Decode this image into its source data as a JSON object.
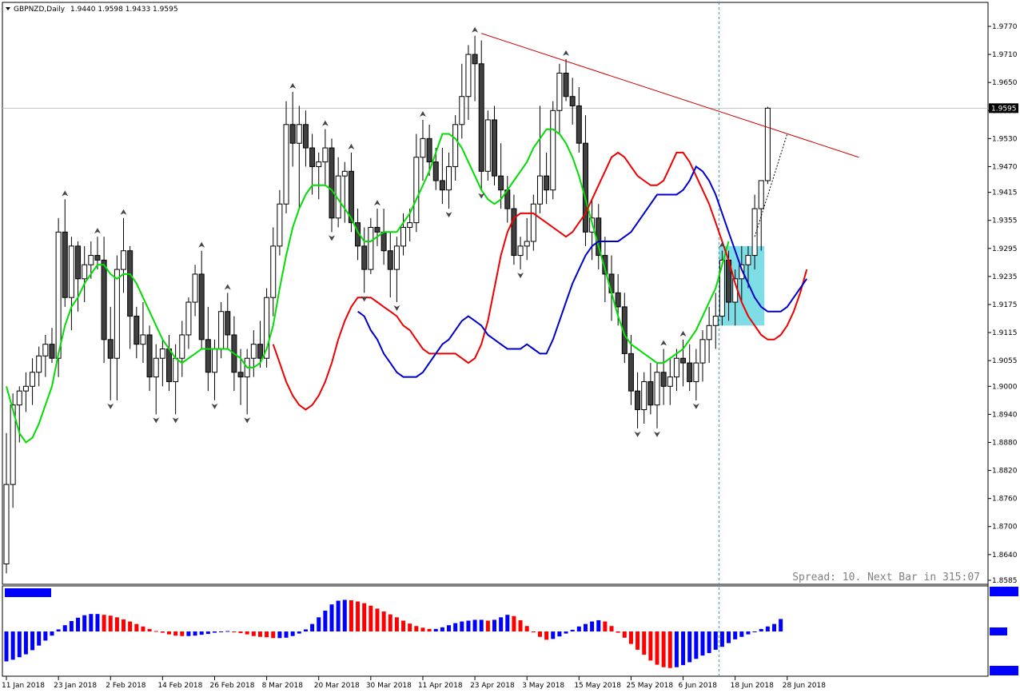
{
  "header": {
    "symbol_label": "GBPNZD,Daily",
    "ohlc_label": "1.9440 1.9598 1.9433 1.9595",
    "menu_icon": "triangle-down-icon"
  },
  "status": {
    "spread_text": "Spread: 10. Next Bar in 315:07"
  },
  "colors": {
    "background": "#ffffff",
    "grid_border": "#000000",
    "bull_body": "#ffffff",
    "bear_body": "#404040",
    "ma_fast": "#00dd00",
    "ma_mid": "#ee0000",
    "ma_slow": "#0000cc",
    "trendline": "#cc0000",
    "zone": "#7fdde6",
    "hist_up": "#0000ff",
    "hist_down": "#ff0000",
    "vline": "#2a9db5",
    "price_line": "#c0c0c0"
  },
  "chart_data": {
    "type": "candlestick",
    "symbol": "GBPNZD",
    "timeframe": "Daily",
    "y_ticks": [
      "1.9770",
      "1.9710",
      "1.9650",
      "1.9590",
      "1.9530",
      "1.9470",
      "1.9415",
      "1.9355",
      "1.9295",
      "1.9235",
      "1.9175",
      "1.9115",
      "1.9055",
      "1.9000",
      "1.8940",
      "1.8880",
      "1.8820",
      "1.8760",
      "1.8700",
      "1.8640",
      "1.8585"
    ],
    "ylim": [
      1.8575,
      1.981
    ],
    "x_ticks": [
      "11 Jan 2018",
      "23 Jan 2018",
      "2 Feb 2018",
      "14 Feb 2018",
      "26 Feb 2018",
      "8 Mar 2018",
      "20 Mar 2018",
      "30 Mar 2018",
      "11 Apr 2018",
      "23 Apr 2018",
      "3 May 2018",
      "15 May 2018",
      "25 May 2018",
      "6 Jun 2018",
      "18 Jun 2018",
      "28 Jun 2018"
    ],
    "x_tick_index": [
      0,
      8,
      16,
      24,
      32,
      40,
      48,
      56,
      64,
      72,
      80,
      88,
      96,
      104,
      112,
      120
    ],
    "current_price": "1.9595",
    "candles": [
      [
        1.862,
        1.89,
        1.86,
        1.879
      ],
      [
        1.879,
        1.8985,
        1.874,
        1.896
      ],
      [
        1.896,
        1.9,
        1.888,
        1.899
      ],
      [
        1.899,
        1.903,
        1.8945,
        1.9
      ],
      [
        1.9,
        1.906,
        1.896,
        1.903
      ],
      [
        1.903,
        1.9085,
        1.9,
        1.9065
      ],
      [
        1.9065,
        1.911,
        1.902,
        1.909
      ],
      [
        1.909,
        1.9125,
        1.905,
        1.906
      ],
      [
        1.906,
        1.936,
        1.902,
        1.933
      ],
      [
        1.933,
        1.94,
        1.917,
        1.919
      ],
      [
        1.919,
        1.932,
        1.912,
        1.93
      ],
      [
        1.93,
        1.931,
        1.916,
        1.923
      ],
      [
        1.923,
        1.93,
        1.918,
        1.926
      ],
      [
        1.926,
        1.931,
        1.923,
        1.928
      ],
      [
        1.928,
        1.932,
        1.925,
        1.927
      ],
      [
        1.927,
        1.932,
        1.905,
        1.91
      ],
      [
        1.91,
        1.917,
        1.897,
        1.906
      ],
      [
        1.906,
        1.928,
        1.897,
        1.925
      ],
      [
        1.925,
        1.936,
        1.92,
        1.929
      ],
      [
        1.929,
        1.93,
        1.908,
        1.915
      ],
      [
        1.915,
        1.917,
        1.906,
        1.909
      ],
      [
        1.909,
        1.918,
        1.905,
        1.911
      ],
      [
        1.911,
        1.913,
        1.899,
        1.902
      ],
      [
        1.902,
        1.909,
        1.894,
        1.906
      ],
      [
        1.906,
        1.91,
        1.9,
        1.908
      ],
      [
        1.908,
        1.911,
        1.899,
        1.901
      ],
      [
        1.901,
        1.909,
        1.894,
        1.906
      ],
      [
        1.906,
        1.914,
        1.902,
        1.911
      ],
      [
        1.911,
        1.919,
        1.908,
        1.918
      ],
      [
        1.918,
        1.926,
        1.915,
        1.924
      ],
      [
        1.924,
        1.929,
        1.908,
        1.91
      ],
      [
        1.91,
        1.917,
        1.899,
        1.903
      ],
      [
        1.903,
        1.91,
        1.897,
        1.908
      ],
      [
        1.908,
        1.918,
        1.906,
        1.916
      ],
      [
        1.916,
        1.92,
        1.908,
        1.911
      ],
      [
        1.911,
        1.915,
        1.899,
        1.903
      ],
      [
        1.903,
        1.908,
        1.896,
        1.902
      ],
      [
        1.902,
        1.908,
        1.894,
        1.906
      ],
      [
        1.906,
        1.912,
        1.902,
        1.909
      ],
      [
        1.909,
        1.914,
        1.904,
        1.906
      ],
      [
        1.906,
        1.921,
        1.904,
        1.919
      ],
      [
        1.919,
        1.934,
        1.915,
        1.93
      ],
      [
        1.93,
        1.942,
        1.928,
        1.939
      ],
      [
        1.939,
        1.961,
        1.937,
        1.956
      ],
      [
        1.956,
        1.963,
        1.947,
        1.952
      ],
      [
        1.952,
        1.96,
        1.938,
        1.956
      ],
      [
        1.956,
        1.959,
        1.947,
        1.951
      ],
      [
        1.951,
        1.954,
        1.941,
        1.947
      ],
      [
        1.947,
        1.95,
        1.94,
        1.948
      ],
      [
        1.948,
        1.955,
        1.943,
        1.951
      ],
      [
        1.951,
        1.953,
        1.933,
        1.936
      ],
      [
        1.936,
        1.949,
        1.934,
        1.945
      ],
      [
        1.945,
        1.948,
        1.935,
        1.946
      ],
      [
        1.946,
        1.95,
        1.933,
        1.935
      ],
      [
        1.935,
        1.938,
        1.927,
        1.93
      ],
      [
        1.93,
        1.934,
        1.92,
        1.925
      ],
      [
        1.925,
        1.936,
        1.924,
        1.934
      ],
      [
        1.934,
        1.938,
        1.93,
        1.933
      ],
      [
        1.933,
        1.938,
        1.926,
        1.929
      ],
      [
        1.929,
        1.933,
        1.919,
        1.925
      ],
      [
        1.925,
        1.932,
        1.918,
        1.93
      ],
      [
        1.93,
        1.937,
        1.928,
        1.934
      ],
      [
        1.934,
        1.938,
        1.931,
        1.935
      ],
      [
        1.935,
        1.954,
        1.933,
        1.949
      ],
      [
        1.949,
        1.957,
        1.944,
        1.953
      ],
      [
        1.953,
        1.956,
        1.945,
        1.948
      ],
      [
        1.948,
        1.951,
        1.942,
        1.944
      ],
      [
        1.944,
        1.951,
        1.939,
        1.942
      ],
      [
        1.942,
        1.95,
        1.938,
        1.947
      ],
      [
        1.947,
        1.958,
        1.944,
        1.956
      ],
      [
        1.956,
        1.969,
        1.953,
        1.962
      ],
      [
        1.962,
        1.973,
        1.957,
        1.971
      ],
      [
        1.971,
        1.975,
        1.961,
        1.969
      ],
      [
        1.969,
        1.974,
        1.942,
        1.946
      ],
      [
        1.946,
        1.959,
        1.944,
        1.957
      ],
      [
        1.957,
        1.96,
        1.943,
        1.945
      ],
      [
        1.945,
        1.952,
        1.938,
        1.942
      ],
      [
        1.942,
        1.945,
        1.935,
        1.938
      ],
      [
        1.938,
        1.941,
        1.926,
        1.928
      ],
      [
        1.928,
        1.932,
        1.925,
        1.93
      ],
      [
        1.93,
        1.936,
        1.927,
        1.931
      ],
      [
        1.931,
        1.941,
        1.929,
        1.939
      ],
      [
        1.939,
        1.96,
        1.937,
        1.945
      ],
      [
        1.945,
        1.95,
        1.939,
        1.942
      ],
      [
        1.942,
        1.961,
        1.94,
        1.959
      ],
      [
        1.959,
        1.969,
        1.954,
        1.967
      ],
      [
        1.967,
        1.97,
        1.961,
        1.962
      ],
      [
        1.962,
        1.966,
        1.956,
        1.96
      ],
      [
        1.96,
        1.964,
        1.95,
        1.952
      ],
      [
        1.952,
        1.958,
        1.93,
        1.933
      ],
      [
        1.933,
        1.94,
        1.927,
        1.936
      ],
      [
        1.936,
        1.939,
        1.925,
        1.928
      ],
      [
        1.928,
        1.932,
        1.918,
        1.924
      ],
      [
        1.924,
        1.928,
        1.914,
        1.92
      ],
      [
        1.92,
        1.924,
        1.913,
        1.917
      ],
      [
        1.917,
        1.92,
        1.905,
        1.907
      ],
      [
        1.907,
        1.911,
        1.896,
        1.899
      ],
      [
        1.899,
        1.903,
        1.891,
        1.895
      ],
      [
        1.895,
        1.903,
        1.892,
        1.901
      ],
      [
        1.901,
        1.905,
        1.894,
        1.896
      ],
      [
        1.896,
        1.905,
        1.891,
        1.903
      ],
      [
        1.903,
        1.908,
        1.896,
        1.9
      ],
      [
        1.9,
        1.906,
        1.896,
        1.902
      ],
      [
        1.902,
        1.908,
        1.899,
        1.906
      ],
      [
        1.906,
        1.91,
        1.9,
        1.905
      ],
      [
        1.905,
        1.909,
        1.899,
        1.901
      ],
      [
        1.901,
        1.908,
        1.897,
        1.905
      ],
      [
        1.905,
        1.912,
        1.901,
        1.91
      ],
      [
        1.91,
        1.917,
        1.905,
        1.913
      ],
      [
        1.913,
        1.92,
        1.908,
        1.915
      ],
      [
        1.915,
        1.929,
        1.913,
        1.927
      ],
      [
        1.927,
        1.929,
        1.914,
        1.918
      ],
      [
        1.918,
        1.925,
        1.913,
        1.923
      ],
      [
        1.923,
        1.93,
        1.918,
        1.926
      ],
      [
        1.926,
        1.93,
        1.921,
        1.928
      ],
      [
        1.928,
        1.941,
        1.925,
        1.938
      ],
      [
        1.938,
        1.944,
        1.929,
        1.944
      ],
      [
        1.944,
        1.9598,
        1.9433,
        1.9595
      ]
    ],
    "ma_fast": [
      1.9,
      1.895,
      1.89,
      1.888,
      1.889,
      1.892,
      1.896,
      1.9,
      1.907,
      1.913,
      1.917,
      1.919,
      1.922,
      1.924,
      1.926,
      1.926,
      1.924,
      1.923,
      1.924,
      1.924,
      1.922,
      1.919,
      1.916,
      1.913,
      1.91,
      1.908,
      1.906,
      1.905,
      1.906,
      1.907,
      1.908,
      1.908,
      1.908,
      1.908,
      1.908,
      1.907,
      1.906,
      1.904,
      1.904,
      1.905,
      1.908,
      1.913,
      1.921,
      1.928,
      1.934,
      1.938,
      1.941,
      1.943,
      1.943,
      1.943,
      1.942,
      1.94,
      1.938,
      1.936,
      1.933,
      1.931,
      1.931,
      1.932,
      1.933,
      1.933,
      1.933,
      1.935,
      1.937,
      1.94,
      1.943,
      1.946,
      1.95,
      1.954,
      1.954,
      1.953,
      1.951,
      1.948,
      1.945,
      1.942,
      1.94,
      1.939,
      1.94,
      1.942,
      1.944,
      1.946,
      1.948,
      1.951,
      1.953,
      1.955,
      1.955,
      1.954,
      1.952,
      1.949,
      1.945,
      1.94,
      1.935,
      1.93,
      1.925,
      1.92,
      1.915,
      1.911,
      1.909,
      1.908,
      1.907,
      1.906,
      1.905,
      1.905,
      1.906,
      1.907,
      1.908,
      1.91,
      1.912,
      1.915,
      1.918,
      1.921,
      1.926,
      1.931
    ],
    "ma_mid": [
      1.909,
      1.905,
      1.901,
      1.898,
      1.896,
      1.895,
      1.896,
      1.898,
      1.901,
      1.905,
      1.91,
      1.914,
      1.917,
      1.919,
      1.919,
      1.919,
      1.918,
      1.917,
      1.916,
      1.915,
      1.913,
      1.912,
      1.91,
      1.908,
      1.907,
      1.907,
      1.907,
      1.907,
      1.907,
      1.906,
      1.905,
      1.906,
      1.909,
      1.914,
      1.921,
      1.928,
      1.933,
      1.936,
      1.937,
      1.937,
      1.937,
      1.936,
      1.935,
      1.934,
      1.933,
      1.932,
      1.933,
      1.935,
      1.937,
      1.94,
      1.943,
      1.946,
      1.949,
      1.95,
      1.949,
      1.947,
      1.945,
      1.944,
      1.943,
      1.943,
      1.944,
      1.947,
      1.95,
      1.95,
      1.948,
      1.945,
      1.942,
      1.939,
      1.935,
      1.931,
      1.927,
      1.922,
      1.918,
      1.915,
      1.913,
      1.911,
      1.91,
      1.91,
      1.911,
      1.913,
      1.916,
      1.92,
      1.925
    ],
    "ma_slow": [
      1.916,
      1.915,
      1.912,
      1.91,
      1.907,
      1.905,
      1.903,
      1.902,
      1.902,
      1.902,
      1.903,
      1.905,
      1.907,
      1.909,
      1.91,
      1.912,
      1.914,
      1.915,
      1.914,
      1.913,
      1.911,
      1.91,
      1.909,
      1.908,
      1.908,
      1.908,
      1.909,
      1.908,
      1.907,
      1.907,
      1.91,
      1.914,
      1.918,
      1.922,
      1.925,
      1.928,
      1.93,
      1.931,
      1.931,
      1.931,
      1.931,
      1.932,
      1.933,
      1.935,
      1.937,
      1.939,
      1.941,
      1.941,
      1.941,
      1.941,
      1.942,
      1.944,
      1.947,
      1.946,
      1.944,
      1.941,
      1.937,
      1.933,
      1.929,
      1.925,
      1.922,
      1.919,
      1.917,
      1.916,
      1.916,
      1.916,
      1.917,
      1.919,
      1.921,
      1.923
    ],
    "histogram": [
      -0.72,
      -0.68,
      -0.62,
      -0.55,
      -0.45,
      -0.34,
      -0.22,
      -0.1,
      0.05,
      0.15,
      0.25,
      0.33,
      0.39,
      0.42,
      0.42,
      0.4,
      0.38,
      0.34,
      0.29,
      0.24,
      0.18,
      0.12,
      0.06,
      0.01,
      -0.03,
      -0.07,
      -0.1,
      -0.11,
      -0.11,
      -0.1,
      -0.08,
      -0.06,
      -0.03,
      -0.01,
      0.01,
      -0.02,
      -0.04,
      -0.07,
      -0.11,
      -0.13,
      -0.14,
      -0.16,
      -0.16,
      -0.15,
      -0.11,
      -0.05,
      0.05,
      0.18,
      0.34,
      0.5,
      0.65,
      0.74,
      0.76,
      0.75,
      0.72,
      0.68,
      0.62,
      0.55,
      0.48,
      0.41,
      0.34,
      0.26,
      0.19,
      0.13,
      0.09,
      0.06,
      0.06,
      0.1,
      0.15,
      0.2,
      0.24,
      0.26,
      0.28,
      0.28,
      0.26,
      0.28,
      0.34,
      0.4,
      0.37,
      0.27,
      0.13,
      -0.02,
      -0.13,
      -0.2,
      -0.18,
      -0.12,
      -0.05,
      0.04,
      0.12,
      0.18,
      0.24,
      0.27,
      0.24,
      0.13,
      -0.03,
      -0.15,
      -0.3,
      -0.44,
      -0.56,
      -0.7,
      -0.8,
      -0.86,
      -0.88,
      -0.86,
      -0.81,
      -0.74,
      -0.66,
      -0.58,
      -0.52,
      -0.44,
      -0.37,
      -0.28,
      -0.19,
      -0.13,
      -0.07,
      0.0,
      0.06,
      0.12,
      0.18,
      0.3
    ]
  }
}
